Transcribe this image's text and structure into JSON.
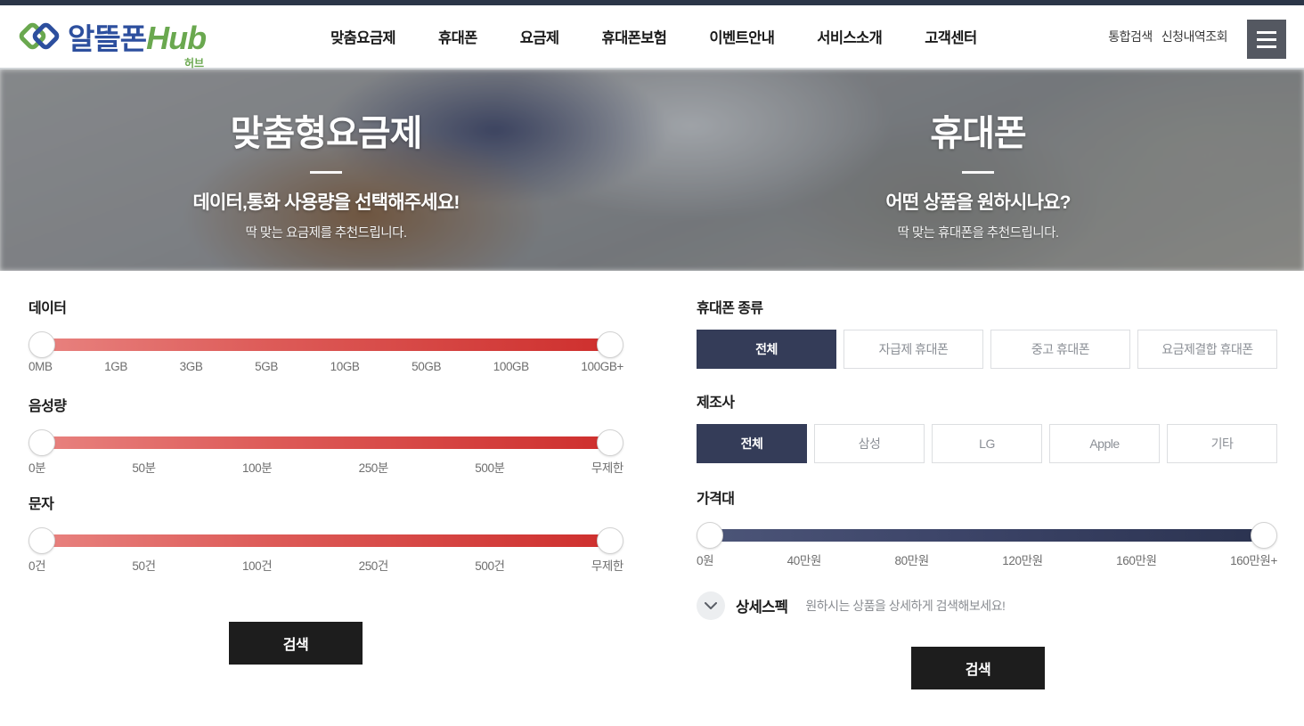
{
  "brand": {
    "name_kr": "알뜰폰",
    "name_en": "Hub",
    "name_sub": "허브",
    "logo_green": "#6aa84f",
    "logo_blue": "#2d4f9e"
  },
  "nav": {
    "items": [
      {
        "label": "맞춤요금제"
      },
      {
        "label": "휴대폰"
      },
      {
        "label": "요금제"
      },
      {
        "label": "휴대폰보험"
      },
      {
        "label": "이벤트안내"
      },
      {
        "label": "서비스소개"
      },
      {
        "label": "고객센터"
      }
    ],
    "utility": [
      {
        "label": "통합검색"
      },
      {
        "label": "신청내역조회"
      }
    ],
    "menu_icon": "hamburger-icon"
  },
  "hero": {
    "left": {
      "title": "맞춤형요금제",
      "lead": "데이터,통화 사용량을 선택해주세요!",
      "sub": "딱 맞는 요금제를 추천드립니다."
    },
    "right": {
      "title": "휴대폰",
      "lead": "어떤 상품을 원하시나요?",
      "sub": "딱 맞는 휴대폰을 추천드립니다."
    }
  },
  "left_panel": {
    "sliders": [
      {
        "label": "데이터",
        "color": "#ce2f2d",
        "ticks": [
          "0MB",
          "1GB",
          "3GB",
          "5GB",
          "10GB",
          "50GB",
          "100GB",
          "100GB+"
        ],
        "min_value": "0MB",
        "max_value": "100GB+"
      },
      {
        "label": "음성량",
        "color": "#ce2f2d",
        "ticks": [
          "0분",
          "50분",
          "100분",
          "250분",
          "500분",
          "무제한"
        ],
        "min_value": "0분",
        "max_value": "무제한"
      },
      {
        "label": "문자",
        "color": "#ce2f2d",
        "ticks": [
          "0건",
          "50건",
          "100건",
          "250건",
          "500건",
          "무제한"
        ],
        "min_value": "0건",
        "max_value": "무제한"
      }
    ],
    "search_label": "검색"
  },
  "right_panel": {
    "phone_type": {
      "label": "휴대폰 종류",
      "options": [
        {
          "label": "전체",
          "selected": true
        },
        {
          "label": "자급제 휴대폰",
          "selected": false
        },
        {
          "label": "중고 휴대폰",
          "selected": false
        },
        {
          "label": "요금제결합 휴대폰",
          "selected": false
        }
      ]
    },
    "manufacturer": {
      "label": "제조사",
      "options": [
        {
          "label": "전체",
          "selected": true
        },
        {
          "label": "삼성",
          "selected": false
        },
        {
          "label": "LG",
          "selected": false
        },
        {
          "label": "Apple",
          "selected": false
        },
        {
          "label": "기타",
          "selected": false
        }
      ]
    },
    "price_slider": {
      "label": "가격대",
      "color": "#2b3350",
      "ticks": [
        "0원",
        "40만원",
        "80만원",
        "120만원",
        "160만원",
        "160만원+"
      ],
      "min_value": "0원",
      "max_value": "160만원+"
    },
    "detail_spec": {
      "icon": "chevron-down-icon",
      "title": "상세스펙",
      "hint": "원하시는 상품을 상세하게 검색해보세요!"
    },
    "search_label": "검색"
  },
  "colors": {
    "selected_chip": "#343c58",
    "search_button": "#1d1d1d",
    "top_strip": "#2b3648"
  }
}
